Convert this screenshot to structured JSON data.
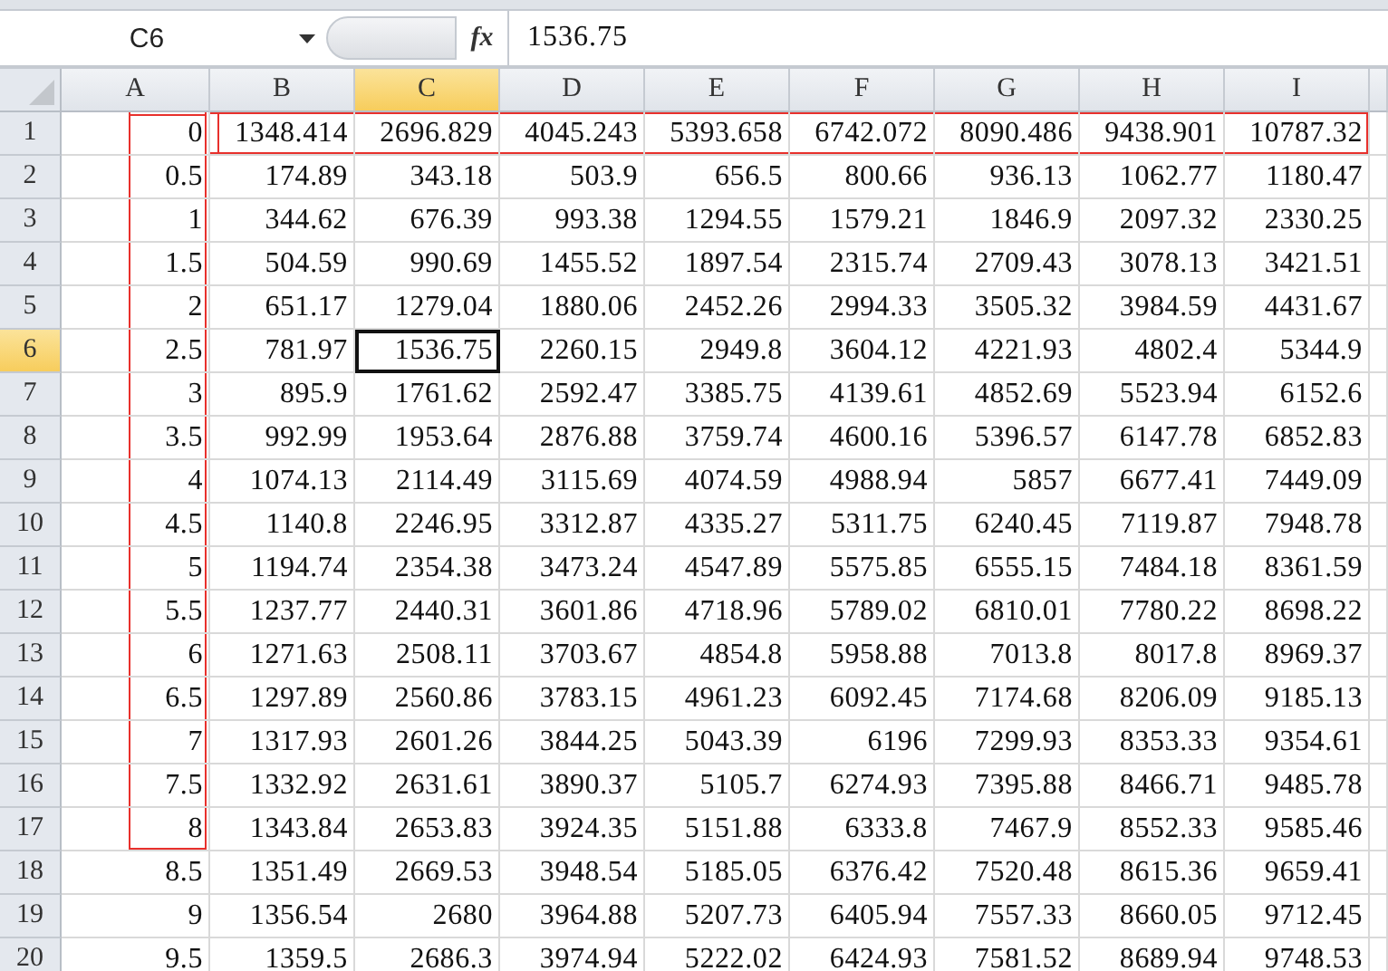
{
  "formula_bar": {
    "name_box": "C6",
    "fx": "fx",
    "formula": "1536.75"
  },
  "columns": [
    {
      "label": "A",
      "selected": false
    },
    {
      "label": "B",
      "selected": false
    },
    {
      "label": "C",
      "selected": true
    },
    {
      "label": "D",
      "selected": false
    },
    {
      "label": "E",
      "selected": false
    },
    {
      "label": "F",
      "selected": false
    },
    {
      "label": "G",
      "selected": false
    },
    {
      "label": "H",
      "selected": false
    },
    {
      "label": "I",
      "selected": false
    }
  ],
  "rows": [
    {
      "header": "1",
      "selected": false,
      "a_boxed": true,
      "values_boxed": true,
      "cells": [
        "0",
        "1348.414",
        "2696.829",
        "4045.243",
        "5393.658",
        "6742.072",
        "8090.486",
        "9438.901",
        "10787.32"
      ]
    },
    {
      "header": "2",
      "selected": false,
      "a_boxed": true,
      "values_boxed": false,
      "cells": [
        "0.5",
        "174.89",
        "343.18",
        "503.9",
        "656.5",
        "800.66",
        "936.13",
        "1062.77",
        "1180.47"
      ]
    },
    {
      "header": "3",
      "selected": false,
      "a_boxed": true,
      "values_boxed": false,
      "cells": [
        "1",
        "344.62",
        "676.39",
        "993.38",
        "1294.55",
        "1579.21",
        "1846.9",
        "2097.32",
        "2330.25"
      ]
    },
    {
      "header": "4",
      "selected": false,
      "a_boxed": true,
      "values_boxed": false,
      "cells": [
        "1.5",
        "504.59",
        "990.69",
        "1455.52",
        "1897.54",
        "2315.74",
        "2709.43",
        "3078.13",
        "3421.51"
      ]
    },
    {
      "header": "5",
      "selected": false,
      "a_boxed": true,
      "values_boxed": false,
      "cells": [
        "2",
        "651.17",
        "1279.04",
        "1880.06",
        "2452.26",
        "2994.33",
        "3505.32",
        "3984.59",
        "4431.67"
      ]
    },
    {
      "header": "6",
      "selected": true,
      "a_boxed": true,
      "values_boxed": false,
      "cells": [
        "2.5",
        "781.97",
        "1536.75",
        "2260.15",
        "2949.8",
        "3604.12",
        "4221.93",
        "4802.4",
        "5344.9"
      ]
    },
    {
      "header": "7",
      "selected": false,
      "a_boxed": true,
      "values_boxed": false,
      "cells": [
        "3",
        "895.9",
        "1761.62",
        "2592.47",
        "3385.75",
        "4139.61",
        "4852.69",
        "5523.94",
        "6152.6"
      ]
    },
    {
      "header": "8",
      "selected": false,
      "a_boxed": true,
      "values_boxed": false,
      "cells": [
        "3.5",
        "992.99",
        "1953.64",
        "2876.88",
        "3759.74",
        "4600.16",
        "5396.57",
        "6147.78",
        "6852.83"
      ]
    },
    {
      "header": "9",
      "selected": false,
      "a_boxed": true,
      "values_boxed": false,
      "cells": [
        "4",
        "1074.13",
        "2114.49",
        "3115.69",
        "4074.59",
        "4988.94",
        "5857",
        "6677.41",
        "7449.09"
      ]
    },
    {
      "header": "10",
      "selected": false,
      "a_boxed": true,
      "values_boxed": false,
      "cells": [
        "4.5",
        "1140.8",
        "2246.95",
        "3312.87",
        "4335.27",
        "5311.75",
        "6240.45",
        "7119.87",
        "7948.78"
      ]
    },
    {
      "header": "11",
      "selected": false,
      "a_boxed": true,
      "values_boxed": false,
      "cells": [
        "5",
        "1194.74",
        "2354.38",
        "3473.24",
        "4547.89",
        "5575.85",
        "6555.15",
        "7484.18",
        "8361.59"
      ]
    },
    {
      "header": "12",
      "selected": false,
      "a_boxed": true,
      "values_boxed": false,
      "cells": [
        "5.5",
        "1237.77",
        "2440.31",
        "3601.86",
        "4718.96",
        "5789.02",
        "6810.01",
        "7780.22",
        "8698.22"
      ]
    },
    {
      "header": "13",
      "selected": false,
      "a_boxed": true,
      "values_boxed": false,
      "cells": [
        "6",
        "1271.63",
        "2508.11",
        "3703.67",
        "4854.8",
        "5958.88",
        "7013.8",
        "8017.8",
        "8969.37"
      ]
    },
    {
      "header": "14",
      "selected": false,
      "a_boxed": true,
      "values_boxed": false,
      "cells": [
        "6.5",
        "1297.89",
        "2560.86",
        "3783.15",
        "4961.23",
        "6092.45",
        "7174.68",
        "8206.09",
        "9185.13"
      ]
    },
    {
      "header": "15",
      "selected": false,
      "a_boxed": true,
      "values_boxed": false,
      "cells": [
        "7",
        "1317.93",
        "2601.26",
        "3844.25",
        "5043.39",
        "6196",
        "7299.93",
        "8353.33",
        "9354.61"
      ]
    },
    {
      "header": "16",
      "selected": false,
      "a_boxed": true,
      "values_boxed": false,
      "cells": [
        "7.5",
        "1332.92",
        "2631.61",
        "3890.37",
        "5105.7",
        "6274.93",
        "7395.88",
        "8466.71",
        "9485.78"
      ]
    },
    {
      "header": "17",
      "selected": false,
      "a_boxed": true,
      "values_boxed": false,
      "cells": [
        "8",
        "1343.84",
        "2653.83",
        "3924.35",
        "5151.88",
        "6333.8",
        "7467.9",
        "8552.33",
        "9585.46"
      ]
    },
    {
      "header": "18",
      "selected": false,
      "a_boxed": false,
      "values_boxed": false,
      "cells": [
        "8.5",
        "1351.49",
        "2669.53",
        "3948.54",
        "5185.05",
        "6376.42",
        "7520.48",
        "8615.36",
        "9659.41"
      ]
    },
    {
      "header": "19",
      "selected": false,
      "a_boxed": false,
      "values_boxed": false,
      "cells": [
        "9",
        "1356.54",
        "2680",
        "3964.88",
        "5207.73",
        "6405.94",
        "7557.33",
        "8660.05",
        "9712.45"
      ]
    },
    {
      "header": "20",
      "selected": false,
      "a_boxed": false,
      "values_boxed": false,
      "cells": [
        "9.5",
        "1359.5",
        "2686.3",
        "3974.94",
        "5222.02",
        "6424.93",
        "7581.52",
        "8689.94",
        "9748.53"
      ]
    }
  ]
}
